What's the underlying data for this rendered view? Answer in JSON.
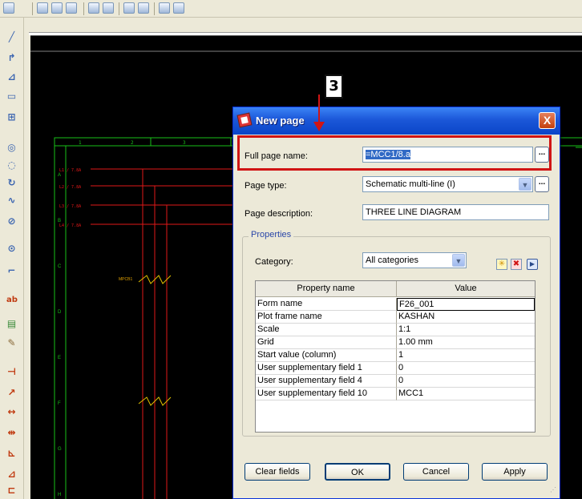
{
  "dialog": {
    "title": "New page",
    "close_label": "X",
    "full_page_name_label": "Full page name:",
    "full_page_name_value": "=MCC1/8.a",
    "page_type_label": "Page type:",
    "page_type_value": "Schematic multi-line (I)",
    "page_description_label": "Page description:",
    "page_description_value": "THREE LINE DIAGRAM",
    "properties_label": "Properties",
    "category_label": "Category:",
    "category_value": "All categories",
    "table_headers": [
      "Property name",
      "Value"
    ],
    "rows": [
      {
        "name": "Form name",
        "value": "F26_001"
      },
      {
        "name": "Plot frame name",
        "value": "KASHAN"
      },
      {
        "name": "Scale",
        "value": "1:1"
      },
      {
        "name": "Grid",
        "value": "1.00 mm"
      },
      {
        "name": "Start value (column)",
        "value": "1"
      },
      {
        "name": "User supplementary field 1",
        "value": "0"
      },
      {
        "name": "User supplementary field 4",
        "value": "0"
      },
      {
        "name": "User supplementary field 10",
        "value": "MCC1"
      }
    ],
    "buttons": {
      "clear": "Clear fields",
      "ok": "OK",
      "cancel": "Cancel",
      "apply": "Apply"
    },
    "ellipsis": "..."
  },
  "annotation": {
    "step_number": "3",
    "color": "#d01414"
  },
  "schematic": {
    "column_numbers": [
      "1",
      "2",
      "3"
    ],
    "row_letters": [
      "A",
      "B",
      "C",
      "D",
      "E",
      "F",
      "G",
      "H"
    ],
    "line_labels": [
      "L1 / 7.8A",
      "L2 / 7.8A",
      "L3 / 7.8A",
      "L4 / 7.8A"
    ],
    "breaker_label": "MPCB1",
    "colors": {
      "background": "#000000",
      "frame": "#18c018",
      "wire": "#e01818"
    }
  }
}
